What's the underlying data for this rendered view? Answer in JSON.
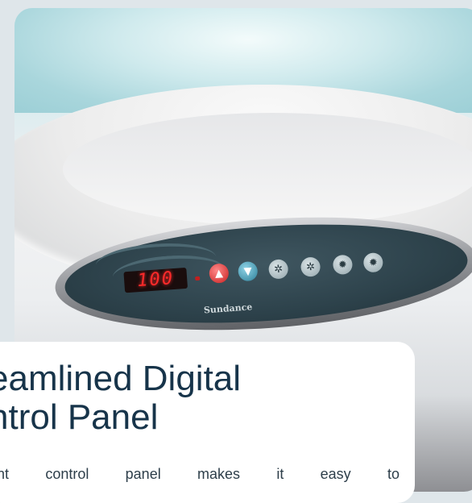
{
  "hero": {
    "panel": {
      "display_value": "100",
      "brand": "Sundance",
      "buttons": [
        {
          "icon": "temp-up-icon",
          "glyph": "▲"
        },
        {
          "icon": "temp-down-icon",
          "glyph": "▼"
        },
        {
          "icon": "jets-1-icon",
          "glyph": "✲"
        },
        {
          "icon": "jets-2-icon",
          "glyph": "✲"
        },
        {
          "icon": "light-icon",
          "glyph": "✹"
        },
        {
          "icon": "light-mode-icon",
          "glyph": "✹"
        }
      ]
    }
  },
  "card": {
    "title_line1": "eamlined Digital",
    "title_line2": "ntrol Panel",
    "body_text": "ent control panel makes it easy to"
  },
  "colors": {
    "title": "#17344a",
    "card_bg": "#ffffff",
    "led": "#ff2a2a"
  }
}
